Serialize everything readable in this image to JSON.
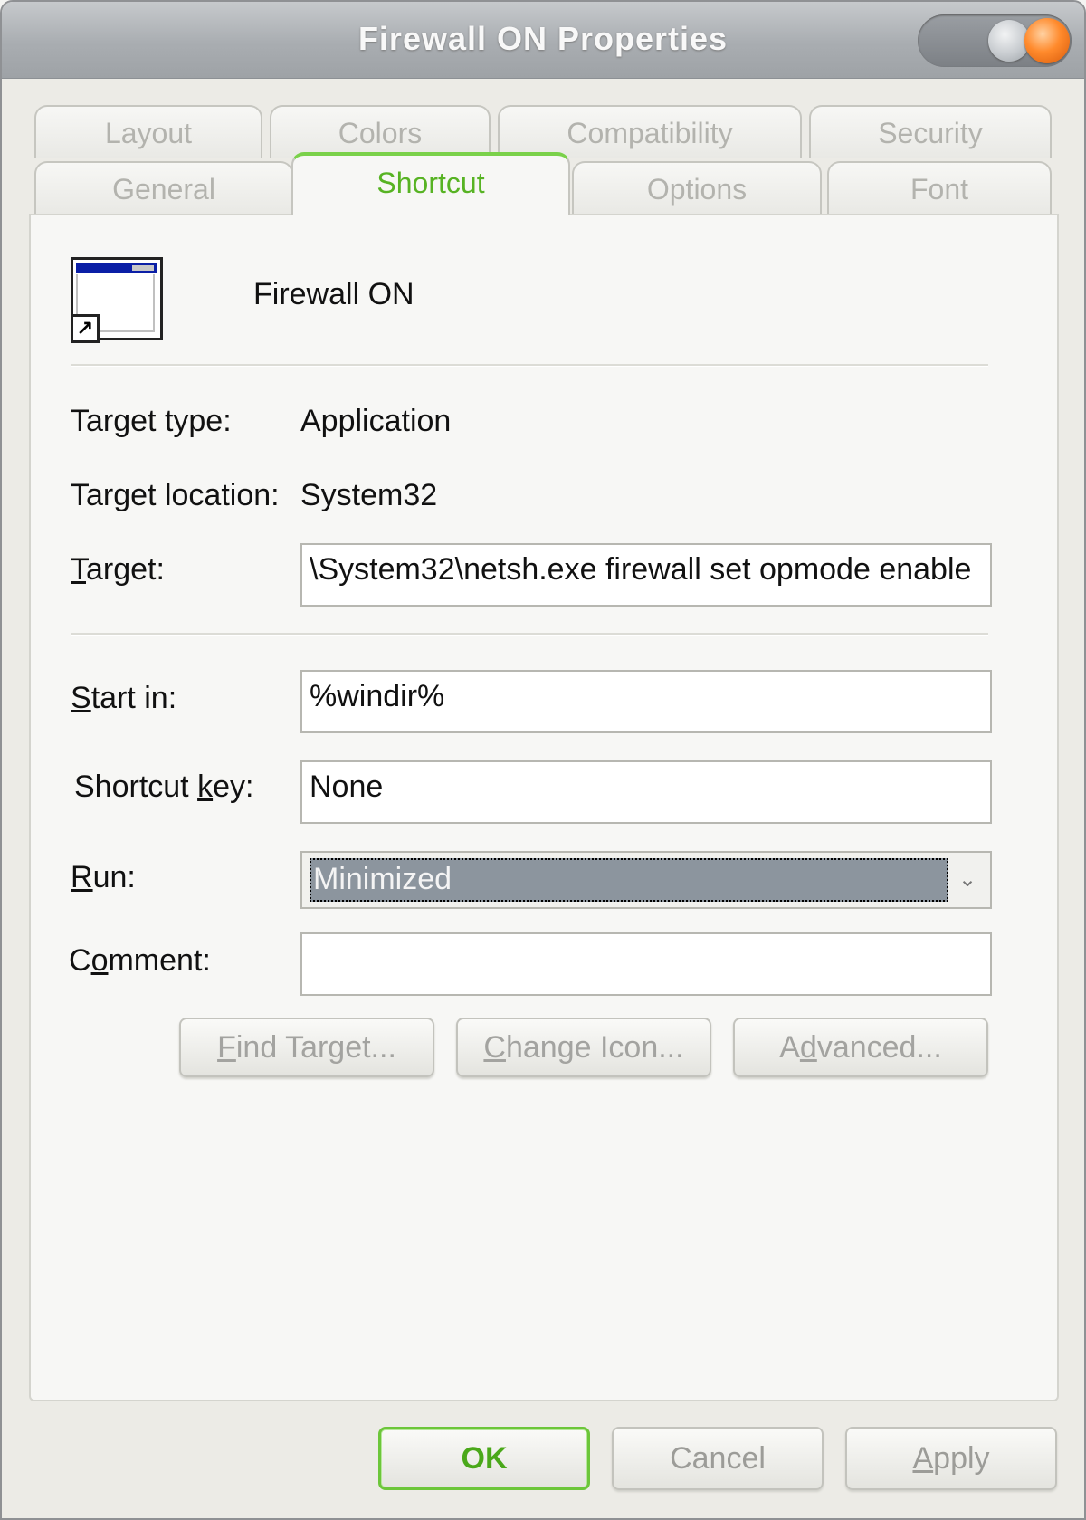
{
  "window": {
    "title": "Firewall ON Properties"
  },
  "tabs_row1": [
    {
      "label": "Layout"
    },
    {
      "label": "Colors"
    },
    {
      "label": "Compatibility"
    },
    {
      "label": "Security"
    }
  ],
  "tabs_row2": [
    {
      "label": "General"
    },
    {
      "label": "Shortcut",
      "active": true
    },
    {
      "label": "Options"
    },
    {
      "label": "Font"
    }
  ],
  "header": {
    "name": "Firewall ON",
    "icon": "application-shortcut-icon"
  },
  "fields": {
    "target_type": {
      "label": "Target type:",
      "value": "Application"
    },
    "target_location": {
      "label": "Target location:",
      "value": "System32"
    },
    "target": {
      "label_pre": "",
      "label_u": "T",
      "label_post": "arget:",
      "value": "\\System32\\netsh.exe firewall set opmode enable"
    },
    "start_in": {
      "label_u": "S",
      "label_post": "tart in:",
      "value": "%windir%"
    },
    "shortcut_key": {
      "label_pre": "Shortcut ",
      "label_u": "k",
      "label_post": "ey:",
      "value": "None"
    },
    "run": {
      "label_u": "R",
      "label_post": "un:",
      "value": "Minimized"
    },
    "comment": {
      "label_pre": "C",
      "label_u": "o",
      "label_post": "mment:",
      "value": ""
    }
  },
  "action_buttons": {
    "find_target": {
      "u": "F",
      "rest": "ind Target..."
    },
    "change_icon": {
      "u": "C",
      "rest": "hange Icon..."
    },
    "advanced": {
      "pre": "A",
      "u": "d",
      "rest": "vanced..."
    }
  },
  "footer": {
    "ok": "OK",
    "cancel": "Cancel",
    "apply_u": "A",
    "apply_rest": "pply"
  },
  "colors": {
    "accent": "#6cc63a",
    "active_tab_text": "#57b323",
    "close_button": "#ff8a2c"
  }
}
